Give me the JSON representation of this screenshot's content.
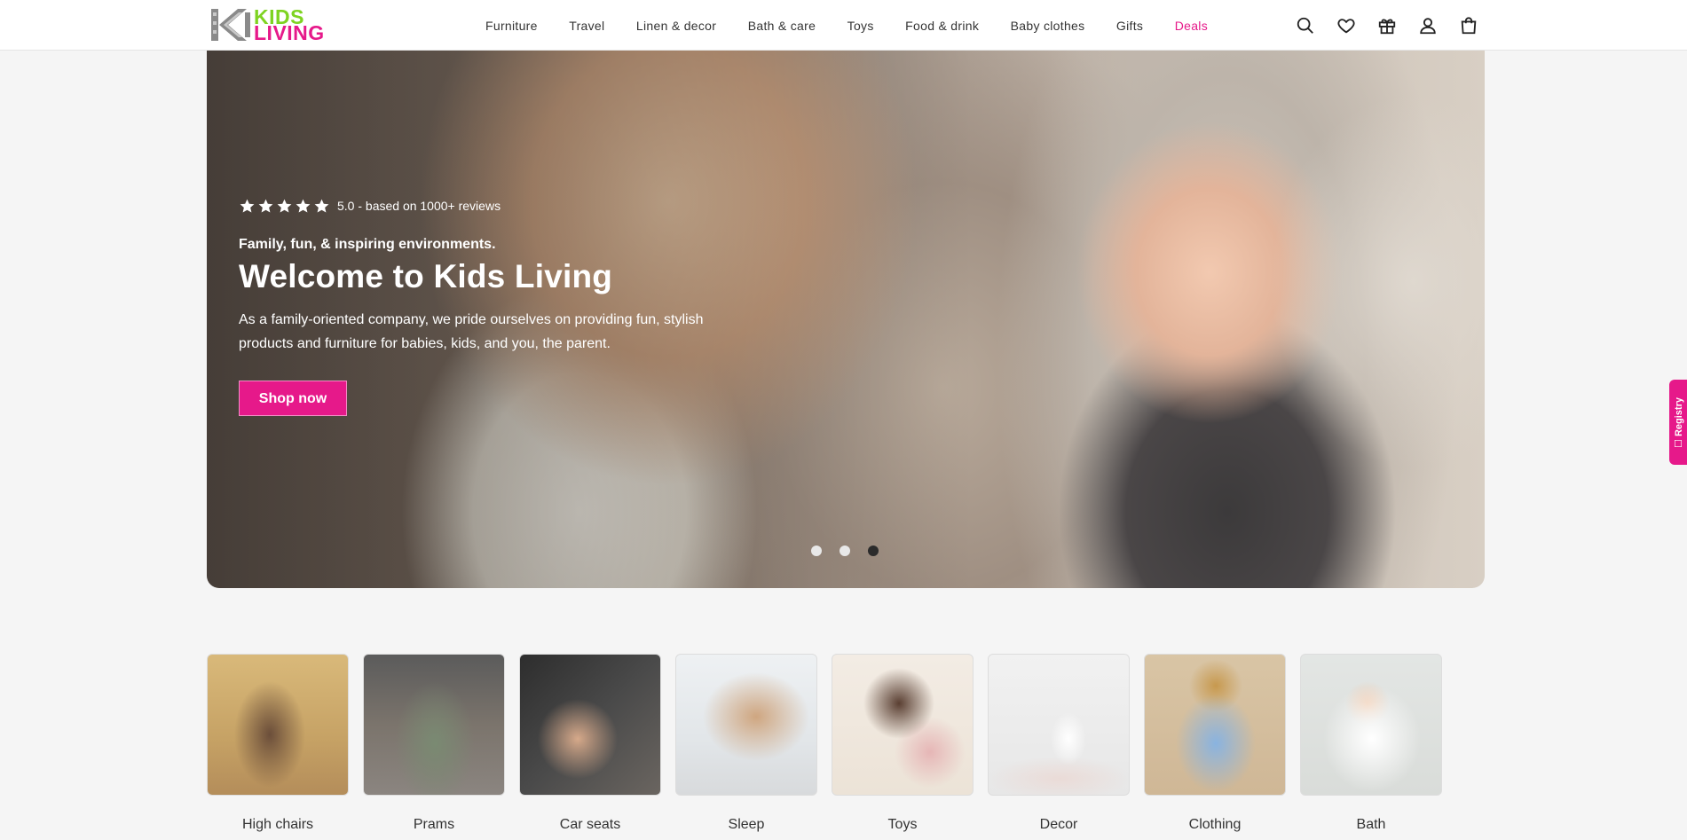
{
  "brand": {
    "logo_kids": "KIDS",
    "logo_living": "LIVING",
    "accent_pink": "#e6198a",
    "accent_green": "#7ed321"
  },
  "nav": {
    "items": [
      {
        "label": "Furniture"
      },
      {
        "label": "Travel"
      },
      {
        "label": "Linen & decor"
      },
      {
        "label": "Bath & care"
      },
      {
        "label": "Toys"
      },
      {
        "label": "Food & drink"
      },
      {
        "label": "Baby clothes"
      },
      {
        "label": "Gifts"
      },
      {
        "label": "Deals"
      }
    ]
  },
  "header_icons": [
    "search-icon",
    "heart-icon",
    "gift-icon",
    "account-icon",
    "bag-icon"
  ],
  "hero": {
    "rating_text": "5.0 - based on 1000+ reviews",
    "star_count": 5,
    "eyebrow": "Family, fun, & inspiring environments.",
    "title": "Welcome to Kids Living",
    "description": "As a family-oriented company, we pride ourselves on providing fun, stylish products and furniture for babies, kids, and you, the parent.",
    "cta_label": "Shop now",
    "slide_count": 3,
    "active_slide": 3
  },
  "registry": {
    "label": "Registry"
  },
  "categories": [
    {
      "label": "High chairs"
    },
    {
      "label": "Prams"
    },
    {
      "label": "Car seats"
    },
    {
      "label": "Sleep"
    },
    {
      "label": "Toys"
    },
    {
      "label": "Decor"
    },
    {
      "label": "Clothing"
    },
    {
      "label": "Bath"
    }
  ]
}
